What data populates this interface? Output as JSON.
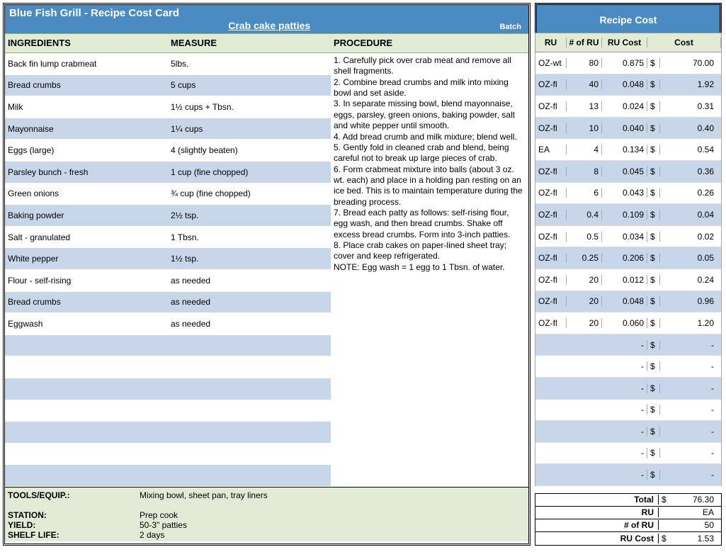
{
  "header": {
    "title": "Blue Fish Grill - Recipe Cost Card",
    "recipe_name": "Crab cake patties",
    "batch_label": "Batch"
  },
  "columns": {
    "ingredients": "INGREDIENTS",
    "measure": "MEASURE",
    "procedure": "PROCEDURE"
  },
  "ingredients": [
    {
      "name": "Back fin lump crabmeat",
      "measure": "5lbs."
    },
    {
      "name": "Bread crumbs",
      "measure": "5 cups"
    },
    {
      "name": "Milk",
      "measure": "1½ cups + Tbsn."
    },
    {
      "name": "Mayonnaise",
      "measure": "1¼ cups"
    },
    {
      "name": "Eggs (large)",
      "measure": "4 (slightly beaten)"
    },
    {
      "name": "Parsley bunch - fresh",
      "measure": "1 cup (fine chopped)"
    },
    {
      "name": "Green onions",
      "measure": "¾ cup (fine chopped)"
    },
    {
      "name": "Baking powder",
      "measure": "2½ tsp."
    },
    {
      "name": "Salt - granulated",
      "measure": "1 Tbsn."
    },
    {
      "name": "White pepper",
      "measure": "1½ tsp."
    },
    {
      "name": "Flour - self-rising",
      "measure": "as needed"
    },
    {
      "name": "Bread crumbs",
      "measure": "as needed"
    },
    {
      "name": "Eggwash",
      "measure": "as needed"
    },
    {
      "name": "",
      "measure": ""
    },
    {
      "name": "",
      "measure": ""
    },
    {
      "name": "",
      "measure": ""
    },
    {
      "name": "",
      "measure": ""
    },
    {
      "name": "",
      "measure": ""
    },
    {
      "name": "",
      "measure": ""
    },
    {
      "name": "",
      "measure": ""
    }
  ],
  "procedure": [
    "1. Carefully pick over crab meat and remove all shell fragments.",
    "2. Combine bread crumbs and milk into mixing bowl and set aside.",
    "3. In separate missing bowl, blend mayonnaise, eggs, parsley, green onions, baking powder, salt and white pepper until smooth.",
    "4. Add bread crumb and milk mixture; blend well.",
    "5. Gently fold in cleaned crab and blend, being careful not to break up large pieces of crab.",
    "6. Form crabmeat mixture into balls (about 3 oz. wt. each) and place in a holding pan resting on an ice bed. This is to maintain temperature during the breading process.",
    "7. Bread each patty as follows: self-rising flour, egg wash, and then bread crumbs. Shake off excess bread crumbs. Form into 3-inch patties.",
    "8. Place crab cakes on paper-lined sheet tray; cover and keep refrigerated.",
    "NOTE: Egg wash = 1 egg to 1 Tbsn. of water."
  ],
  "footer": {
    "tools_label": "TOOLS/EQUIP.:",
    "tools": "Mixing bowl, sheet pan, tray liners",
    "station_label": "STATION:",
    "station": "Prep cook",
    "yield_label": "YIELD:",
    "yield": "50-3\" patties",
    "shelf_label": "SHELF LIFE:",
    "shelf": "2 days"
  },
  "cost_header": "Recipe Cost",
  "cost_columns": {
    "ru": "RU",
    "num_ru": "# of RU",
    "ru_cost": "RU Cost",
    "cost": "Cost"
  },
  "cost_rows": [
    {
      "ru": "OZ-wt",
      "num": "80",
      "rucost": "0.875",
      "d": "$",
      "cost": "70.00"
    },
    {
      "ru": "OZ-fl",
      "num": "40",
      "rucost": "0.048",
      "d": "$",
      "cost": "1.92"
    },
    {
      "ru": "OZ-fl",
      "num": "13",
      "rucost": "0.024",
      "d": "$",
      "cost": "0.31"
    },
    {
      "ru": "OZ-fl",
      "num": "10",
      "rucost": "0.040",
      "d": "$",
      "cost": "0.40"
    },
    {
      "ru": "EA",
      "num": "4",
      "rucost": "0.134",
      "d": "$",
      "cost": "0.54"
    },
    {
      "ru": "OZ-fl",
      "num": "8",
      "rucost": "0.045",
      "d": "$",
      "cost": "0.36"
    },
    {
      "ru": "OZ-fl",
      "num": "6",
      "rucost": "0.043",
      "d": "$",
      "cost": "0.26"
    },
    {
      "ru": "OZ-fl",
      "num": "0.4",
      "rucost": "0.109",
      "d": "$",
      "cost": "0.04"
    },
    {
      "ru": "OZ-fl",
      "num": "0.5",
      "rucost": "0.034",
      "d": "$",
      "cost": "0.02"
    },
    {
      "ru": "OZ-fl",
      "num": "0.25",
      "rucost": "0.206",
      "d": "$",
      "cost": "0.05"
    },
    {
      "ru": "OZ-fl",
      "num": "20",
      "rucost": "0.012",
      "d": "$",
      "cost": "0.24"
    },
    {
      "ru": "OZ-fl",
      "num": "20",
      "rucost": "0.048",
      "d": "$",
      "cost": "0.96"
    },
    {
      "ru": "OZ-fl",
      "num": "20",
      "rucost": "0.060",
      "d": "$",
      "cost": "1.20"
    },
    {
      "ru": "",
      "num": "",
      "rucost": "-",
      "d": "$",
      "cost": "-"
    },
    {
      "ru": "",
      "num": "",
      "rucost": "-",
      "d": "$",
      "cost": "-"
    },
    {
      "ru": "",
      "num": "",
      "rucost": "-",
      "d": "$",
      "cost": "-"
    },
    {
      "ru": "",
      "num": "",
      "rucost": "-",
      "d": "$",
      "cost": "-"
    },
    {
      "ru": "",
      "num": "",
      "rucost": "-",
      "d": "$",
      "cost": "-"
    },
    {
      "ru": "",
      "num": "",
      "rucost": "-",
      "d": "$",
      "cost": "-"
    },
    {
      "ru": "",
      "num": "",
      "rucost": "-",
      "d": "$",
      "cost": "-"
    }
  ],
  "totals": {
    "total_label": "Total",
    "total_d": "$",
    "total_v": "76.30",
    "ru_label": "RU",
    "ru_v": "EA",
    "num_ru_label": "# of RU",
    "num_ru_v": "50",
    "ru_cost_label": "RU Cost",
    "ru_cost_d": "$",
    "ru_cost_v": "1.53"
  }
}
